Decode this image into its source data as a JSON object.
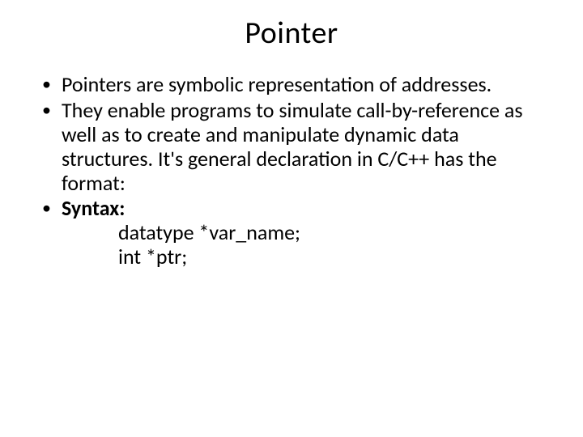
{
  "slide": {
    "title": "Pointer",
    "bullets": [
      {
        "text": "Pointers are symbolic representation of addresses."
      },
      {
        "text": " They enable programs to simulate call-by-reference as well as to create and manipulate dynamic data structures. It's general declaration in C/C++ has the format:"
      },
      {
        "label": "Syntax:",
        "line1": "datatype *var_name;",
        "line2": " int *ptr;"
      }
    ]
  }
}
